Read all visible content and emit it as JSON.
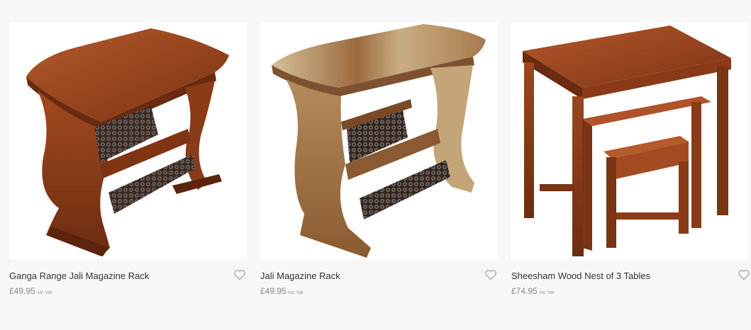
{
  "products": [
    {
      "name": "Ganga Range Jali Magazine Rack",
      "price": "£49.95",
      "vat_note": "inc Vat",
      "image": "dark-wood-magazine-rack",
      "wishlist_icon": "heart-outline-icon"
    },
    {
      "name": "Jali Magazine Rack",
      "price": "£49.95",
      "vat_note": "inc Vat",
      "image": "natural-wood-magazine-rack",
      "wishlist_icon": "heart-outline-icon"
    },
    {
      "name": "Sheesham Wood Nest of 3 Tables",
      "price": "£74.95",
      "vat_note": "inc Vat",
      "image": "nest-of-tables",
      "wishlist_icon": "heart-outline-icon"
    }
  ],
  "colors": {
    "page_background": "#f7f7f7",
    "image_background": "#ffffff",
    "text": "#333333",
    "price_text": "#888888",
    "heart_outline": "#999999"
  }
}
